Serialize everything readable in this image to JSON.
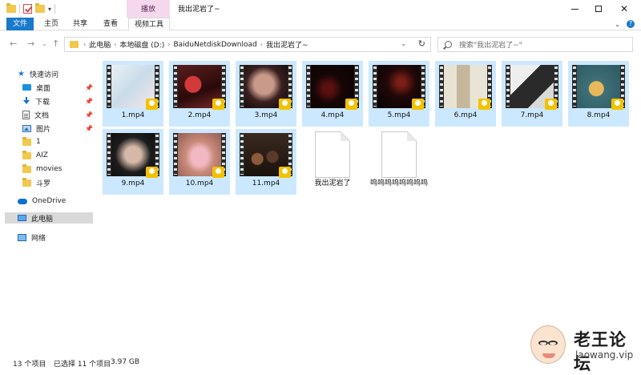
{
  "window": {
    "title": "我出泥岩了~",
    "contextual_tab_group": "播放"
  },
  "ribbon": {
    "tabs": [
      "文件",
      "主页",
      "共享",
      "查看",
      "视频工具"
    ]
  },
  "address": {
    "crumbs": [
      "此电脑",
      "本地磁盘 (D:)",
      "BaiduNetdiskDownload",
      "我出泥岩了~"
    ],
    "search_placeholder": "搜索\"我出泥岩了~\""
  },
  "sidebar": {
    "items": [
      {
        "label": "快速访问",
        "icon": "star-icon"
      },
      {
        "label": "桌面",
        "icon": "desktop-icon",
        "pinned": true
      },
      {
        "label": "下载",
        "icon": "download-icon",
        "pinned": true
      },
      {
        "label": "文档",
        "icon": "document-icon",
        "pinned": true
      },
      {
        "label": "图片",
        "icon": "pictures-icon",
        "pinned": true
      },
      {
        "label": "1",
        "icon": "folder-icon"
      },
      {
        "label": "AIZ",
        "icon": "folder-icon"
      },
      {
        "label": "movies",
        "icon": "folder-icon"
      },
      {
        "label": "斗罗",
        "icon": "folder-icon"
      },
      {
        "label": "OneDrive",
        "icon": "onedrive-cloud-icon"
      },
      {
        "label": "此电脑",
        "icon": "this-pc-icon",
        "selected": true
      },
      {
        "label": "网络",
        "icon": "network-icon"
      }
    ]
  },
  "files": [
    {
      "name": "1.mp4",
      "type": "video",
      "selected": true
    },
    {
      "name": "2.mp4",
      "type": "video",
      "selected": true
    },
    {
      "name": "3.mp4",
      "type": "video",
      "selected": true
    },
    {
      "name": "4.mp4",
      "type": "video",
      "selected": true
    },
    {
      "name": "5.mp4",
      "type": "video",
      "selected": true
    },
    {
      "name": "6.mp4",
      "type": "video",
      "selected": true
    },
    {
      "name": "7.mp4",
      "type": "video",
      "selected": true
    },
    {
      "name": "8.mp4",
      "type": "video",
      "selected": true
    },
    {
      "name": "9.mp4",
      "type": "video",
      "selected": true
    },
    {
      "name": "10.mp4",
      "type": "video",
      "selected": true
    },
    {
      "name": "11.mp4",
      "type": "video",
      "selected": true
    },
    {
      "name": "我出泥岩了",
      "type": "document",
      "selected": false
    },
    {
      "name": "呜呜呜呜呜呜呜呜",
      "type": "document",
      "selected": false
    }
  ],
  "status": {
    "item_count": "13 个项目",
    "selected": "已选择 11 个项目",
    "size": "3.97 GB"
  },
  "watermark": {
    "name": "老王论坛",
    "domain": "laowang.vip"
  },
  "colors": {
    "file_tab": "#1979ca",
    "selection": "#cce8ff",
    "contextual_tab": "#f6d8ee",
    "player_badge": "#f2c200"
  }
}
